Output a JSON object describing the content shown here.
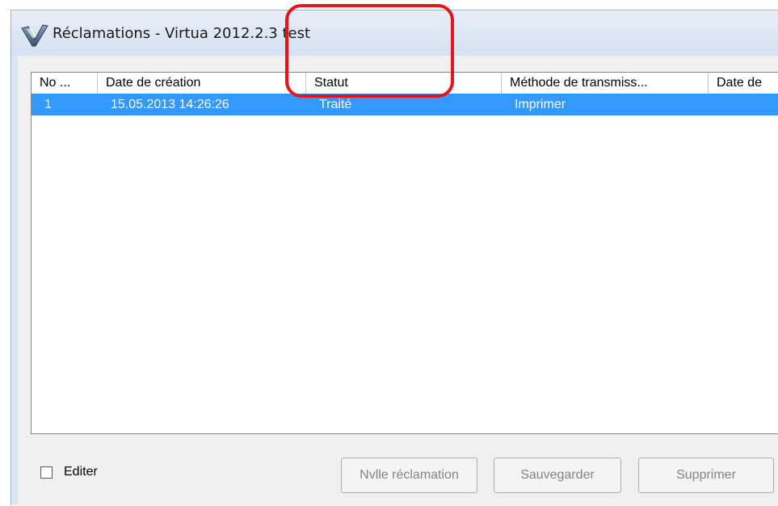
{
  "window": {
    "title": "Réclamations - Virtua 2012.2.3 test"
  },
  "list": {
    "columns": [
      "No ...",
      "Date de création",
      "Statut",
      "Méthode de transmiss...",
      "Date de"
    ],
    "rows": [
      {
        "no": "1",
        "date_creation": "15.05.2013 14:26:26",
        "statut": "Traité",
        "methode": "Imprimer",
        "date": ""
      }
    ],
    "selected_row": 0
  },
  "editer": {
    "label": "Editer",
    "checked": false
  },
  "buttons": {
    "nouvelle": "Nvlle réclamation",
    "sauvegarder": "Sauvegarder",
    "supprimer": "Supprimer"
  },
  "colors": {
    "selection": "#3399ff",
    "highlight": "#e8141a"
  },
  "icons": {
    "app": "virtua-v-icon"
  }
}
